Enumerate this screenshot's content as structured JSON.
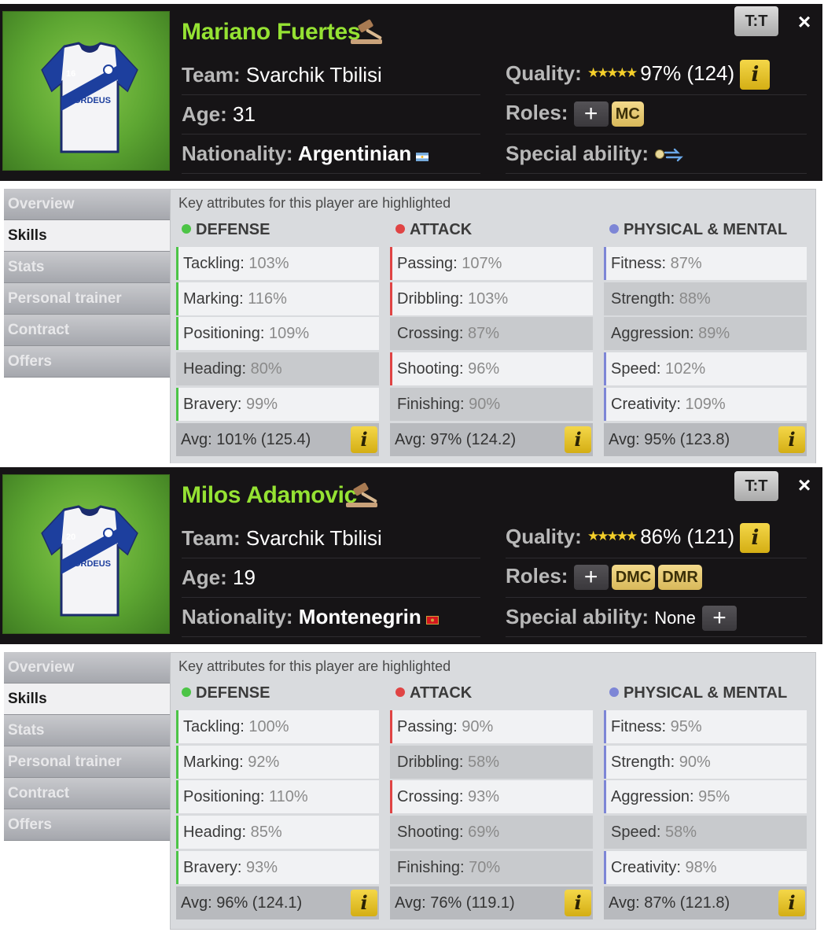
{
  "header_labels": {
    "team": "Team:",
    "age": "Age:",
    "nationality": "Nationality:",
    "quality": "Quality:",
    "roles": "Roles:",
    "special": "Special ability:",
    "kit_button": "T:T",
    "close": "×",
    "info": "i",
    "plus": "+"
  },
  "tabs": [
    "Overview",
    "Skills",
    "Stats",
    "Personal trainer",
    "Contract",
    "Offers"
  ],
  "active_tab": "Skills",
  "key_note": "Key attributes for this player are highlighted",
  "column_titles": [
    "DEFENSE",
    "ATTACK",
    "PHYSICAL & MENTAL"
  ],
  "colors": {
    "defense": "#4cc446",
    "attack": "#e04444",
    "physical": "#7d86d6",
    "name": "#95e233"
  },
  "players": [
    {
      "name": "Mariano Fuertes",
      "jersey_number": "16",
      "sponsor": "NORDEUS",
      "team": "Svarchik Tbilisi",
      "age": "31",
      "nationality": "Argentinian",
      "flag": "argentina-flag",
      "quality_stars": "★★★★★",
      "quality": "97% (124)",
      "roles": [
        "MC"
      ],
      "special_ability": "",
      "special_icon": "ball-pass-icon",
      "defense": [
        {
          "label": "Tackling:",
          "value": "103%",
          "key": true
        },
        {
          "label": "Marking:",
          "value": "116%",
          "key": true
        },
        {
          "label": "Positioning:",
          "value": "109%",
          "key": true
        },
        {
          "label": "Heading:",
          "value": "80%",
          "key": false
        },
        {
          "label": "Bravery:",
          "value": "99%",
          "key": true
        }
      ],
      "attack": [
        {
          "label": "Passing:",
          "value": "107%",
          "key": true
        },
        {
          "label": "Dribbling:",
          "value": "103%",
          "key": true
        },
        {
          "label": "Crossing:",
          "value": "87%",
          "key": false
        },
        {
          "label": "Shooting:",
          "value": "96%",
          "key": true
        },
        {
          "label": "Finishing:",
          "value": "90%",
          "key": false
        }
      ],
      "physical": [
        {
          "label": "Fitness:",
          "value": "87%",
          "key": true
        },
        {
          "label": "Strength:",
          "value": "88%",
          "key": false
        },
        {
          "label": "Aggression:",
          "value": "89%",
          "key": false
        },
        {
          "label": "Speed:",
          "value": "102%",
          "key": true
        },
        {
          "label": "Creativity:",
          "value": "109%",
          "key": true
        }
      ],
      "averages": [
        "Avg: 101% (125.4)",
        "Avg: 97% (124.2)",
        "Avg: 95% (123.8)"
      ]
    },
    {
      "name": "Milos Adamovic",
      "jersey_number": "20",
      "sponsor": "NORDEUS",
      "team": "Svarchik Tbilisi",
      "age": "19",
      "nationality": "Montenegrin",
      "flag": "montenegro-flag",
      "quality_stars": "★★★★★",
      "quality": "86% (121)",
      "roles": [
        "DMC",
        "DMR"
      ],
      "special_ability": "None",
      "special_icon": "",
      "defense": [
        {
          "label": "Tackling:",
          "value": "100%",
          "key": true
        },
        {
          "label": "Marking:",
          "value": "92%",
          "key": true
        },
        {
          "label": "Positioning:",
          "value": "110%",
          "key": true
        },
        {
          "label": "Heading:",
          "value": "85%",
          "key": true
        },
        {
          "label": "Bravery:",
          "value": "93%",
          "key": true
        }
      ],
      "attack": [
        {
          "label": "Passing:",
          "value": "90%",
          "key": true
        },
        {
          "label": "Dribbling:",
          "value": "58%",
          "key": false
        },
        {
          "label": "Crossing:",
          "value": "93%",
          "key": true
        },
        {
          "label": "Shooting:",
          "value": "69%",
          "key": false
        },
        {
          "label": "Finishing:",
          "value": "70%",
          "key": false
        }
      ],
      "physical": [
        {
          "label": "Fitness:",
          "value": "95%",
          "key": true
        },
        {
          "label": "Strength:",
          "value": "90%",
          "key": true
        },
        {
          "label": "Aggression:",
          "value": "95%",
          "key": true
        },
        {
          "label": "Speed:",
          "value": "58%",
          "key": false
        },
        {
          "label": "Creativity:",
          "value": "98%",
          "key": true
        }
      ],
      "averages": [
        "Avg: 96% (124.1)",
        "Avg: 76% (119.1)",
        "Avg: 87% (121.8)"
      ]
    }
  ]
}
